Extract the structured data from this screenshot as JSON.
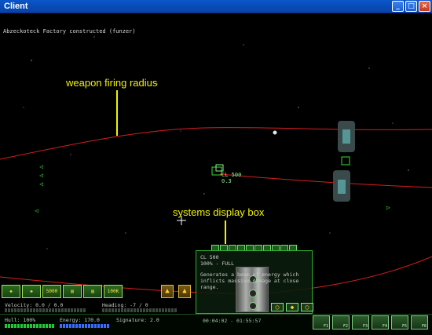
{
  "window": {
    "title": "Client",
    "buttons": [
      "_",
      "□",
      "×"
    ]
  },
  "message_log": "Abzeckoteck Factory constructed (funzer)",
  "annotations": {
    "weapon": "weapon firing radius",
    "systems": "systems display box"
  },
  "target": {
    "name": "CL 500",
    "value": "0.3"
  },
  "systems_box": {
    "tab_count": 10,
    "name": "CL 500",
    "status": "100% - FULL",
    "description": "Generates a beam of energy which inflicts massive damage at close range.",
    "buttons": [
      "ring-icon",
      "shield-icon",
      "ring-icon"
    ]
  },
  "hud": {
    "weapon_buttons": [
      {
        "label": "",
        "icon": "ship-icon"
      },
      {
        "label": "",
        "icon": "ship-icon"
      },
      {
        "label": "5000",
        "icon": "credits-icon"
      },
      {
        "label": "",
        "icon": "cargo-icon"
      },
      {
        "label": "",
        "icon": "cargo-icon"
      },
      {
        "label": "100K",
        "icon": "credits-icon"
      }
    ],
    "arrow_buttons": [
      "▲",
      "▲"
    ],
    "velocity_label": "Velocity: 0.0 / 0.0",
    "heading_label": "Heading: -7 / 0",
    "hull_label": "Hull: 100%",
    "energy_label": "Energy: 170.0",
    "signature_label": "Signature: 2.0",
    "time": "00:04:02 - 01:55:57",
    "ship_slots": [
      "F1",
      "F2",
      "F3",
      "F4",
      "F5",
      "F6"
    ],
    "colors": {
      "hull": "#22c83a",
      "energy": "#3a6cff",
      "accent": "#32e032"
    }
  }
}
